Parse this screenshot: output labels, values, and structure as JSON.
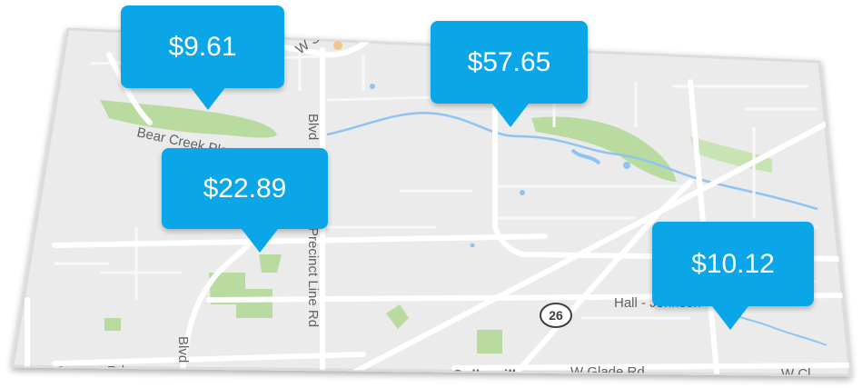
{
  "markers": [
    {
      "id": "marker-1",
      "price": "$9.61"
    },
    {
      "id": "marker-2",
      "price": "$57.65"
    },
    {
      "id": "marker-3",
      "price": "$22.89"
    },
    {
      "id": "marker-4",
      "price": "$10.12"
    }
  ],
  "map": {
    "labels": {
      "bear_creek": "Bear Creek Pkwy",
      "precinct_line": "Precinct Line Rd",
      "blvd_top": "Blvd",
      "blvd_bottom": "Blvd",
      "hall": "Hall - Johnson",
      "route": "26",
      "starnes": "Starnes Rd",
      "colleyville": "Colleyville",
      "glade": "W Glade Rd",
      "w_cl": "W Cl",
      "w_top": "W S"
    }
  },
  "colors": {
    "marker": "#0aa6e8",
    "map_bg": "#ebebeb",
    "road": "#ffffff",
    "park": "#b9dba0",
    "water": "#8fc3f2"
  }
}
